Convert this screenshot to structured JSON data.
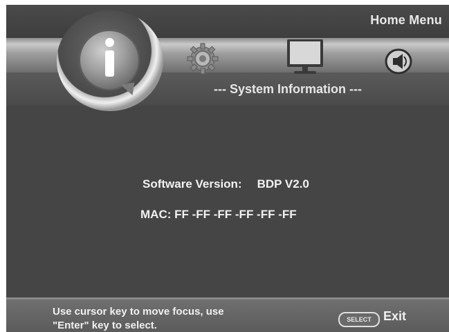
{
  "header": {
    "title": "Home Menu"
  },
  "icons": {
    "active": "info-icon",
    "items": [
      "info-icon",
      "gear-icon",
      "monitor-icon",
      "speaker-icon"
    ]
  },
  "section": {
    "title": "--- System Information ---"
  },
  "content": {
    "software_label": "Software Version:",
    "software_value": "BDP V2.0",
    "mac_line": "MAC: FF -FF -FF -FF -FF -FF"
  },
  "footer": {
    "hint_line1": "Use cursor key to move focus, use",
    "hint_line2": "\"Enter\" key to select.",
    "select_button": "SELECT",
    "exit_label": "Exit"
  },
  "colors": {
    "background": "#454545",
    "text": "#f2f2f2",
    "band": "#b5b5b5"
  }
}
